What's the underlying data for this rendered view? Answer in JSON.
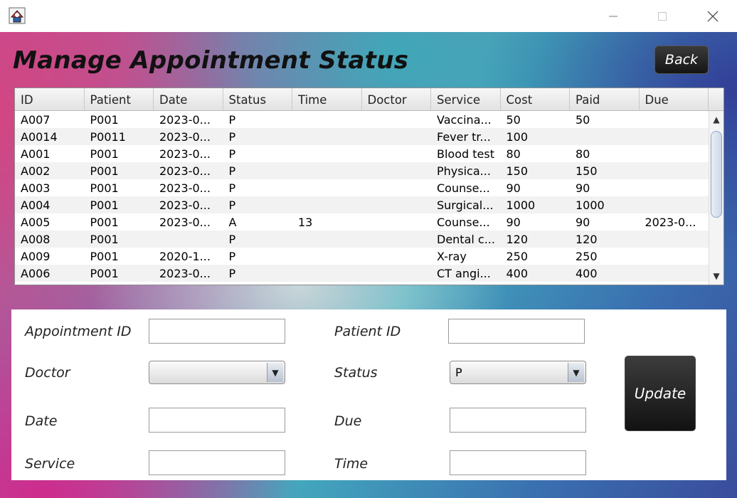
{
  "window": {
    "app_icon": "app-logo-icon",
    "controls": {
      "minimize": "minimize-icon",
      "maximize": "maximize-icon",
      "close": "close-icon"
    }
  },
  "header": {
    "title": "Manage Appointment Status",
    "back_label": "Back"
  },
  "table": {
    "columns": [
      "ID",
      "Patient",
      "Date",
      "Status",
      "Time",
      "Doctor",
      "Service",
      "Cost",
      "Paid",
      "Due"
    ],
    "rows": [
      [
        "A007",
        "P001",
        "2023-0...",
        "P",
        "",
        "",
        "Vaccina...",
        "50",
        "50",
        ""
      ],
      [
        "A0014",
        "P0011",
        "2023-0...",
        "P",
        "",
        "",
        "Fever tr...",
        "100",
        "",
        ""
      ],
      [
        "A001",
        "P001",
        "2023-0...",
        "P",
        "",
        "",
        "Blood test",
        "80",
        "80",
        ""
      ],
      [
        "A002",
        "P001",
        "2023-0...",
        "P",
        "",
        "",
        "Physica...",
        "150",
        "150",
        ""
      ],
      [
        "A003",
        "P001",
        "2023-0...",
        "P",
        "",
        "",
        "Counse...",
        "90",
        "90",
        ""
      ],
      [
        "A004",
        "P001",
        "2023-0...",
        "P",
        "",
        "",
        "Surgical...",
        "1000",
        "1000",
        ""
      ],
      [
        "A005",
        "P001",
        "2023-0...",
        "A",
        "13",
        "",
        "Counse...",
        "90",
        "90",
        "2023-0..."
      ],
      [
        "A008",
        "P001",
        "",
        "P",
        "",
        "",
        "Dental c...",
        "120",
        "120",
        ""
      ],
      [
        "A009",
        "P001",
        "2020-1...",
        "P",
        "",
        "",
        "X-ray",
        "250",
        "250",
        ""
      ],
      [
        "A006",
        "P001",
        "2023-0...",
        "P",
        "",
        "",
        "CT angi...",
        "400",
        "400",
        ""
      ]
    ],
    "scroll_up_icon": "scroll-up-icon",
    "scroll_down_icon": "scroll-down-icon"
  },
  "form": {
    "appointment_id": {
      "label": "Appointment ID",
      "value": ""
    },
    "patient_id": {
      "label": "Patient ID",
      "value": ""
    },
    "doctor": {
      "label": "Doctor",
      "value": ""
    },
    "status": {
      "label": "Status",
      "value": "P"
    },
    "date": {
      "label": "Date",
      "value": ""
    },
    "due": {
      "label": "Due",
      "value": ""
    },
    "service": {
      "label": "Service",
      "value": ""
    },
    "time": {
      "label": "Time",
      "value": ""
    },
    "update_label": "Update",
    "dropdown_icon": "chevron-down-icon"
  }
}
